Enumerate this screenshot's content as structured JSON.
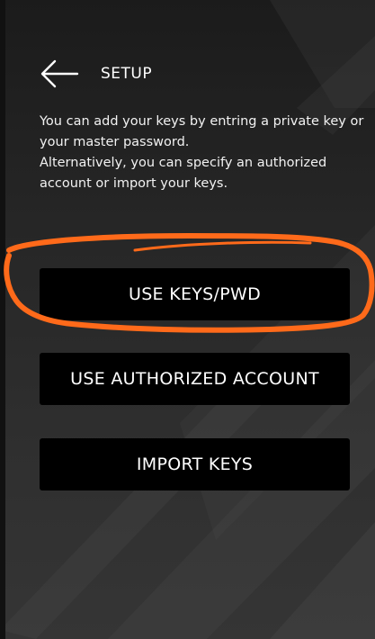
{
  "header": {
    "title": "SETUP",
    "back_icon": "arrow-left-icon"
  },
  "description": {
    "line1": "You can add your keys by entring a private key or your master password.",
    "line2": "Alternatively, you can specify an authorized account or import your keys."
  },
  "buttons": {
    "use_keys": "USE KEYS/PWD",
    "use_authorized": "USE AUTHORIZED ACCOUNT",
    "import_keys": "IMPORT KEYS"
  },
  "colors": {
    "button_bg": "#000000",
    "text": "#ffffff",
    "annotation": "#ff6a1a"
  }
}
